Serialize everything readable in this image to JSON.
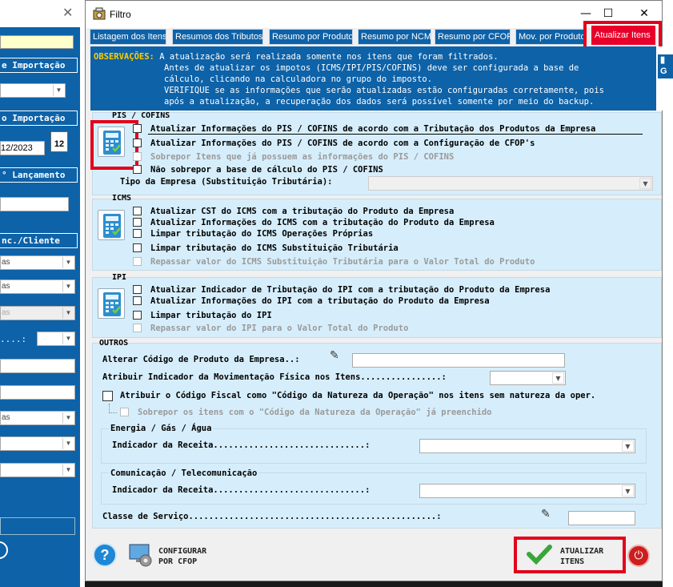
{
  "bg_window": {
    "headers": [
      "e Importação",
      "o Importação",
      "° Lançamento",
      "nc./Cliente"
    ],
    "date_value": "12/2023",
    "calendar_day": "12",
    "select_values": [
      "as",
      "as",
      "as",
      "as",
      ":"
    ]
  },
  "dialog": {
    "title": "Filtro",
    "tabs": [
      {
        "label": "Listagem dos Itens"
      },
      {
        "label": "Resumos dos Tributos"
      },
      {
        "label": "Resumo por Produto"
      },
      {
        "label": "Resumo por NCM"
      },
      {
        "label": "Resumo por CFOP"
      },
      {
        "label": "Mov. por Produto"
      },
      {
        "label": "Atualizar Itens"
      }
    ],
    "observations": {
      "label": "OBSERVAÇÕES:",
      "lines": [
        "A atualização será realizada somente nos itens que foram filtrados.",
        "Antes de atualizar os impotos (ICMS/IPI/PIS/COFINS) deve ser configurada a base de",
        "cálculo, clicando na calculadora no grupo do imposto.",
        "VERIFIQUE se as informações que serão atualizadas estão configuradas corretamente, pois",
        "após a atualização, a recuperação dos dados será possível somente por meio do backup."
      ]
    },
    "pis": {
      "title": "PIS / COFINS",
      "options": [
        "Atualizar Informações do PIS / COFINS de acordo com a Tributação dos Produtos da Empresa",
        "Atualizar Informações do PIS / COFINS de acordo com a Configuração de CFOP's",
        "Sobrepor Itens que já possuem as informações do PIS / COFINS",
        "Não sobrepor a base de cálculo do PIS / COFINS"
      ],
      "tipo_label": "Tipo da Empresa (Substituição Tributária):"
    },
    "icms": {
      "title": "ICMS",
      "options": [
        "Atualizar CST do ICMS com a tributação do Produto da Empresa",
        "Atualizar Informações do ICMS com a tributação do Produto da Empresa",
        "Limpar tributação do ICMS Operações Próprias",
        "Limpar tributação do ICMS Substituição Tributária",
        "Repassar valor do ICMS Substituição Tributária para o Valor Total do Produto"
      ]
    },
    "ipi": {
      "title": "IPI",
      "options": [
        "Atualizar Indicador de Tributação do IPI com a tributação do Produto da Empresa",
        "Atualizar Informações do IPI com a tributação do Produto da Empresa",
        "Limpar tributação do IPI",
        "Repassar valor do IPI para o Valor Total do Produto"
      ]
    },
    "outros": {
      "title": "OUTROS",
      "alterar_label": "Alterar Código de Produto da Empresa..:",
      "atribuir_label": "Atribuir Indicador da Movimentação Física nos Itens................:",
      "atribuir_codigo": "Atribuir o Código Fiscal como \"Código da Natureza da Operação\" nos itens sem natureza da oper.",
      "sobrepor_codigo": "Sobrepor os itens com o \"Código da Natureza da Operação\" já preenchido",
      "energia_title": "Energia / Gás / Água",
      "energia_label": "Indicador da Receita..............................:",
      "comunic_title": "Comunicação / Telecomunicação",
      "comunic_label": "Indicador da Receita..............................:",
      "classe_label": "Classe de Serviço.................................................:"
    },
    "buttons": {
      "configurar": [
        "CONFIGURAR",
        "POR CFOP"
      ],
      "atualizar": [
        "ATUALIZAR",
        "ITENS"
      ]
    }
  }
}
